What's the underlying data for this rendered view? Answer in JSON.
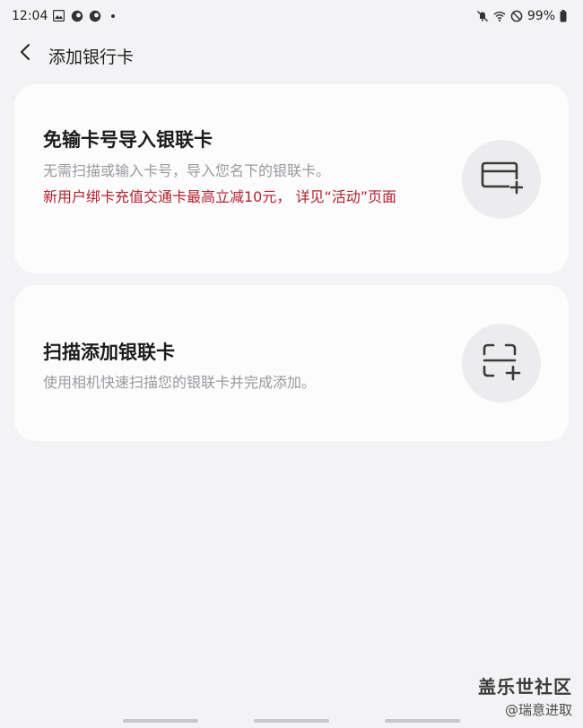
{
  "status_bar": {
    "time": "12:04",
    "battery": "99%",
    "left_icons": [
      "image-icon",
      "app-icon",
      "app-icon",
      "dot-icon"
    ],
    "right_icons": [
      "mute-icon",
      "wifi-icon",
      "dnd-icon",
      "battery-icon"
    ]
  },
  "header": {
    "back_icon": "chevron-left-icon",
    "title": "添加银行卡"
  },
  "cards": [
    {
      "title": "免输卡号导入银联卡",
      "subtitle": "无需扫描或输入卡号，导入您名下的银联卡。",
      "promo": "新用户绑卡充值交通卡最高立减10元， 详见“活动”页面",
      "icon": "card-add-icon"
    },
    {
      "title": "扫描添加银联卡",
      "subtitle": "使用相机快速扫描您的银联卡并完成添加。",
      "icon": "scan-add-icon"
    }
  ],
  "watermark": {
    "title": "盖乐世社区",
    "author": "@瑞意进取"
  },
  "colors": {
    "background": "#f3f3f5",
    "card": "#fcfcfd",
    "promo": "#b3202e",
    "subtitle": "#9a9a9f"
  }
}
